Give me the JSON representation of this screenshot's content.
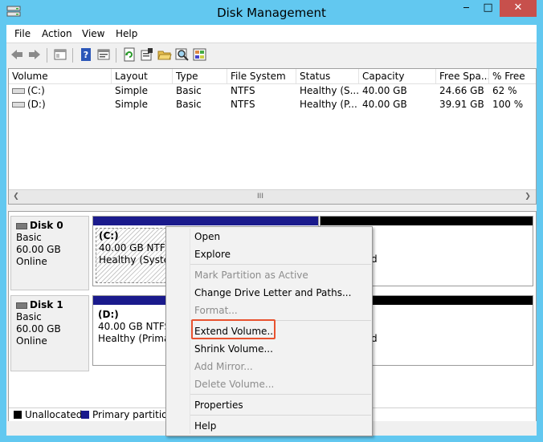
{
  "window": {
    "title": "Disk Management",
    "minimize_glyph": "‒",
    "maximize_glyph": "□",
    "close_glyph": "✕"
  },
  "menu": [
    "File",
    "Action",
    "View",
    "Help"
  ],
  "toolbar_icons": [
    "back-icon",
    "forward-icon",
    "console-icon",
    "help-icon",
    "properties-icon",
    "refresh-icon",
    "settings-icon",
    "open-icon",
    "search-icon",
    "disk-icon"
  ],
  "volume_list": {
    "columns": [
      "Volume",
      "Layout",
      "Type",
      "File System",
      "Status",
      "Capacity",
      "Free Spa...",
      "% Free"
    ],
    "rows": [
      [
        "(C:)",
        "Simple",
        "Basic",
        "NTFS",
        "Healthy (S...",
        "40.00 GB",
        "24.66 GB",
        "62 %"
      ],
      [
        "(D:)",
        "Simple",
        "Basic",
        "NTFS",
        "Healthy (P...",
        "40.00 GB",
        "39.91 GB",
        "100 %"
      ]
    ],
    "scroll_left": "❮",
    "scroll_grip": "III",
    "scroll_right": "❯"
  },
  "disks": [
    {
      "name": "Disk 0",
      "type": "Basic",
      "size": "60.00 GB",
      "state": "Online",
      "partition": {
        "label": "(C:)",
        "size_fs": "40.00 GB NTFS",
        "status": "Healthy (System"
      },
      "second_partition": {
        "text": "d"
      }
    },
    {
      "name": "Disk 1",
      "type": "Basic",
      "size": "60.00 GB",
      "state": "Online",
      "partition": {
        "label": "(D:)",
        "size_fs": "40.00 GB NTFS",
        "status": "Healthy (Primar"
      },
      "second_partition": {
        "text": "d"
      }
    }
  ],
  "legend": [
    {
      "label": "Unallocated",
      "color": "#000000"
    },
    {
      "label": "Primary partition",
      "color": "#1a1a8c"
    }
  ],
  "context_menu": {
    "items": [
      {
        "label": "Open",
        "enabled": true
      },
      {
        "label": "Explore",
        "enabled": true
      },
      {
        "label": "Mark Partition as Active",
        "enabled": false
      },
      {
        "label": "Change Drive Letter and Paths...",
        "enabled": true
      },
      {
        "label": "Format...",
        "enabled": false
      },
      {
        "label": "Extend Volume...",
        "enabled": true,
        "highlighted": true
      },
      {
        "label": "Shrink Volume...",
        "enabled": true
      },
      {
        "label": "Add Mirror...",
        "enabled": false
      },
      {
        "label": "Delete Volume...",
        "enabled": false
      },
      {
        "label": "Properties",
        "enabled": true
      },
      {
        "label": "Help",
        "enabled": true
      }
    ]
  },
  "colors": {
    "title_bar": "#62c8f0",
    "primary_partition": "#1a1a8c",
    "unallocated": "#000000",
    "highlight_outline": "#e8522f",
    "close_button": "#c7504c"
  }
}
